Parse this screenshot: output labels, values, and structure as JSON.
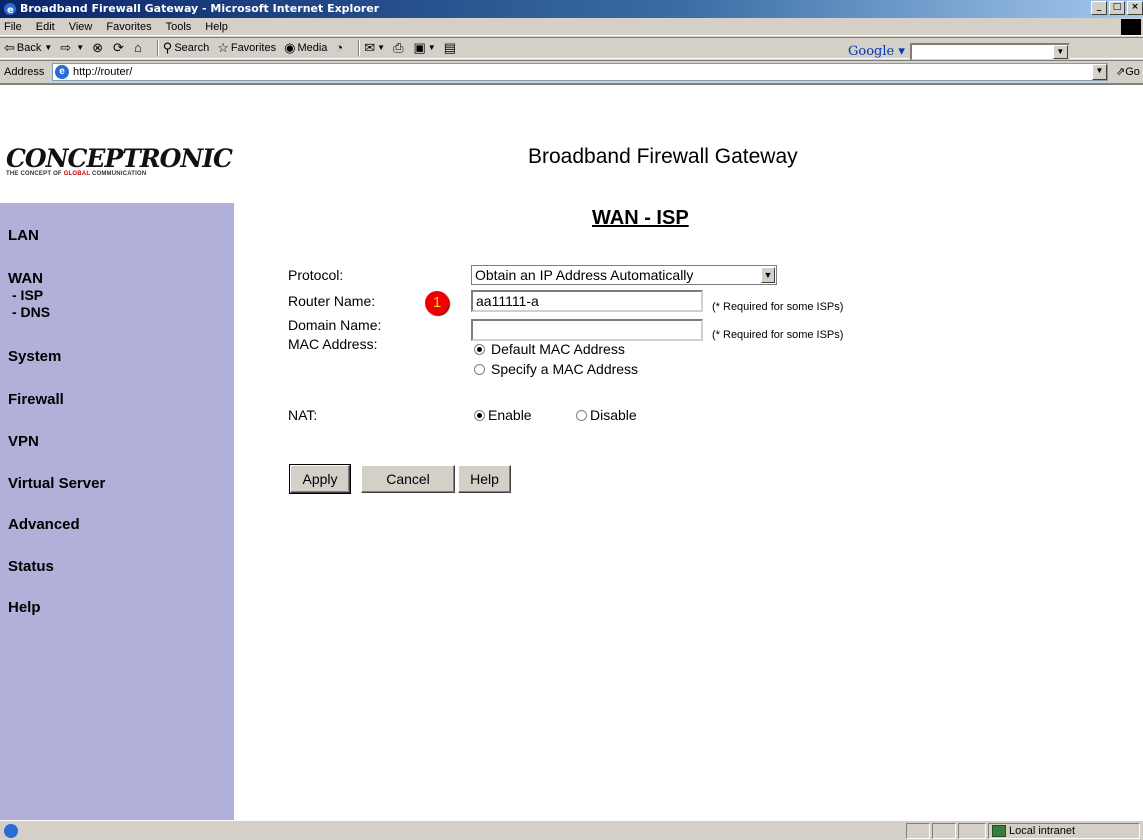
{
  "window": {
    "title": "Broadband Firewall Gateway - Microsoft Internet Explorer",
    "controls": [
      "_",
      "□",
      "×"
    ]
  },
  "menubar": {
    "items": [
      "File",
      "Edit",
      "View",
      "Favorites",
      "Tools",
      "Help"
    ]
  },
  "toolbar": {
    "back": "Back",
    "search": "Search",
    "favorites": "Favorites",
    "media": "Media",
    "google_logo": "Google"
  },
  "address": {
    "label": "Address",
    "url": "http://router/",
    "go": "Go"
  },
  "page": {
    "logo_text": "CONCEPTRONIC",
    "logo_tagline_pre": "THE CONCEPT OF ",
    "logo_tagline_red": "GLOBAL",
    "logo_tagline_post": " COMMUNICATION",
    "title": "Broadband Firewall Gateway",
    "section_title": "WAN - ISP"
  },
  "sidebar": {
    "lan": "LAN",
    "wan": "WAN",
    "wan_isp": "- ISP",
    "wan_dns": "- DNS",
    "system": "System",
    "firewall": "Firewall",
    "vpn": "VPN",
    "virtual_server": "Virtual Server",
    "advanced": "Advanced",
    "status": "Status",
    "help": "Help"
  },
  "form": {
    "protocol_label": "Protocol:",
    "protocol_value": "Obtain an IP Address Automatically",
    "router_name_label": "Router Name:",
    "router_name_value": "aa11111-a",
    "router_name_note": "(* Required for some ISPs)",
    "domain_name_label": "Domain Name:",
    "domain_name_value": "",
    "domain_name_note": "(* Required for some ISPs)",
    "mac_label": "MAC Address:",
    "mac_default": "Default MAC Address",
    "mac_specify": "Specify a MAC Address",
    "mac_selected": "default",
    "nat_label": "NAT:",
    "nat_enable": "Enable",
    "nat_disable": "Disable",
    "nat_selected": "enable",
    "callout_number": "1"
  },
  "buttons": {
    "apply": "Apply",
    "cancel": "Cancel",
    "help": "Help"
  },
  "statusbar": {
    "zone": "Local intranet"
  }
}
